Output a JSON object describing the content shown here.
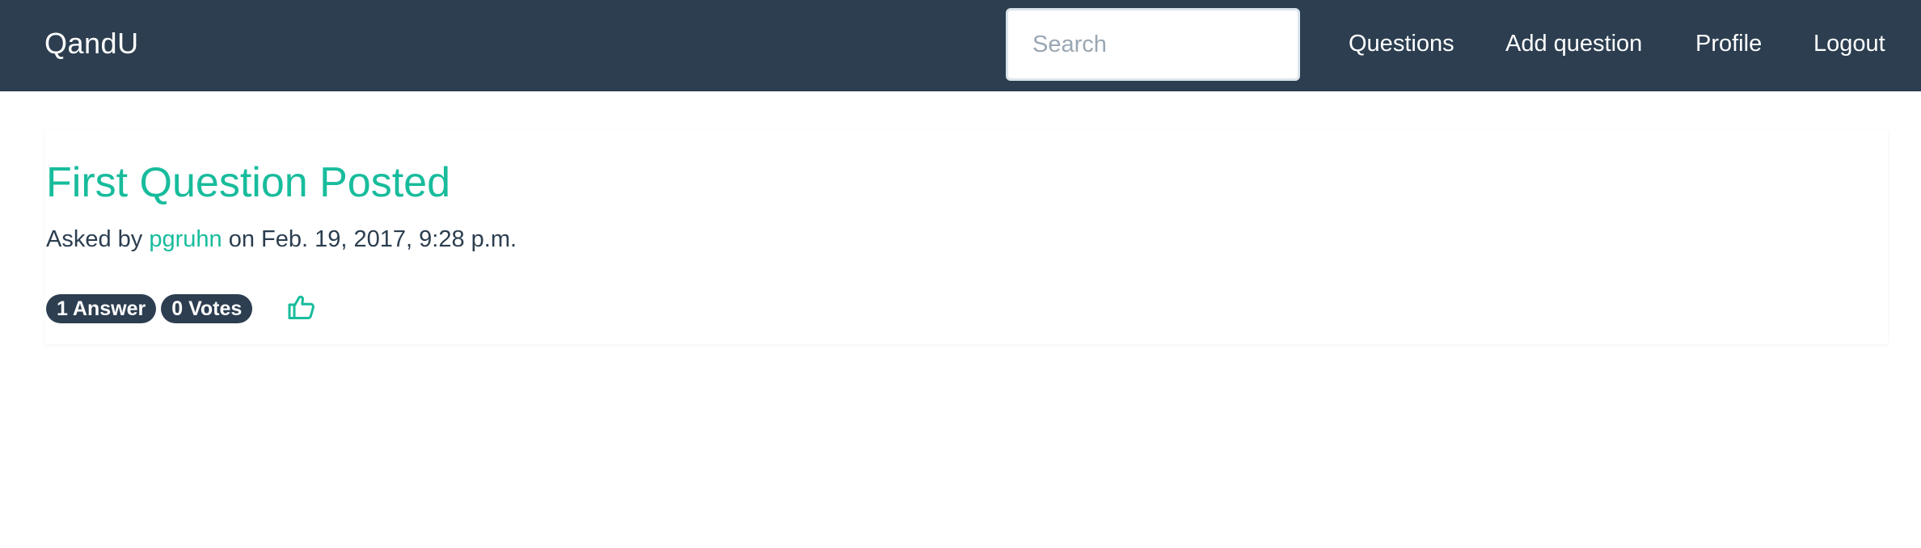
{
  "navbar": {
    "brand": "QandU",
    "search_placeholder": "Search",
    "links": [
      "Questions",
      "Add question",
      "Profile",
      "Logout"
    ]
  },
  "question": {
    "title": "First Question Posted",
    "asked_by_prefix": "Asked by",
    "author": "pgruhn",
    "date_text": "on Feb. 19, 2017, 9:28 p.m.",
    "answers_badge": "1 Answer",
    "votes_badge": "0 Votes",
    "like_icon": "thumbs-up-icon"
  },
  "colors": {
    "navbar_bg": "#2c3e50",
    "accent": "#18bc9c",
    "text": "#2c3e50"
  }
}
